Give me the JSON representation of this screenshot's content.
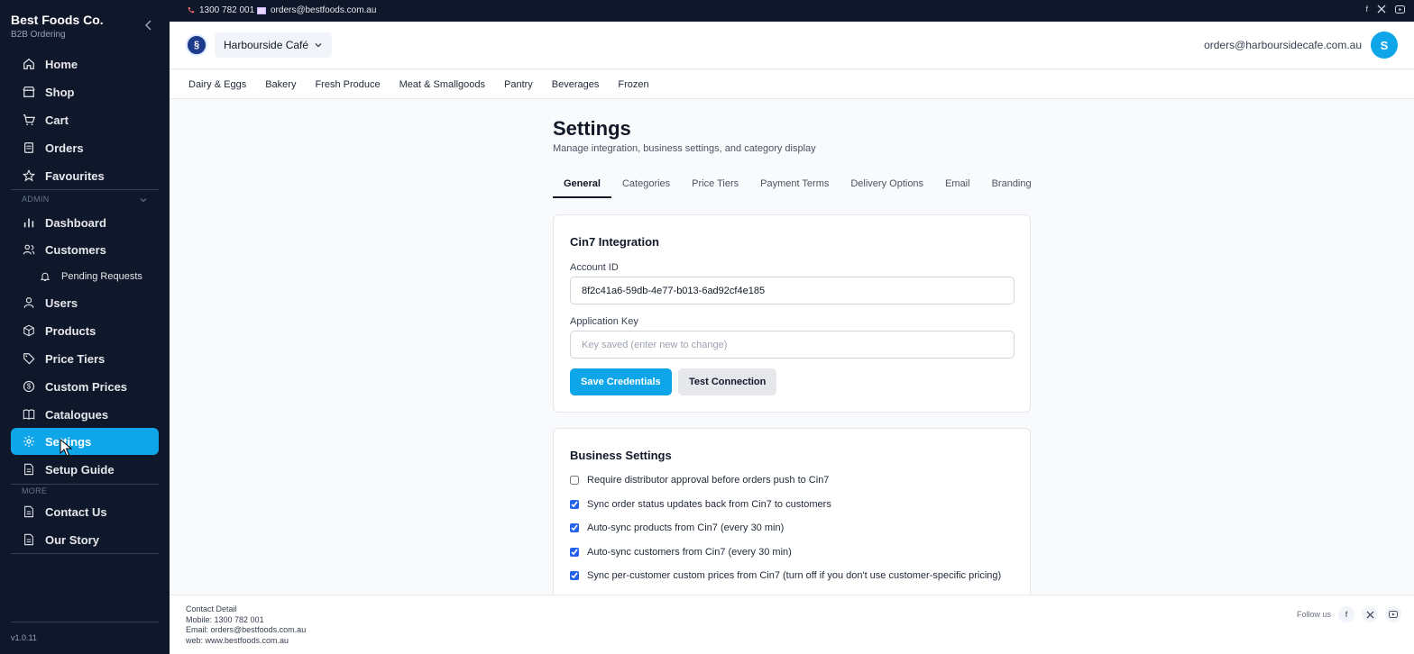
{
  "brand": {
    "name": "Best Foods Co.",
    "subtitle": "B2B Ordering",
    "version": "v1.0.11"
  },
  "sidebar": {
    "main_items": [
      {
        "label": "Home",
        "icon": "home-icon"
      },
      {
        "label": "Shop",
        "icon": "store-icon"
      },
      {
        "label": "Cart",
        "icon": "cart-icon"
      },
      {
        "label": "Orders",
        "icon": "orders-icon"
      },
      {
        "label": "Favourites",
        "icon": "star-icon"
      }
    ],
    "admin_label": "ADMIN",
    "admin_items": [
      {
        "label": "Dashboard",
        "icon": "bar-chart-icon"
      },
      {
        "label": "Customers",
        "icon": "customers-icon"
      },
      {
        "label": "Pending Requests",
        "icon": "bell-icon"
      },
      {
        "label": "Users",
        "icon": "user-icon"
      },
      {
        "label": "Products",
        "icon": "box-icon"
      },
      {
        "label": "Price Tiers",
        "icon": "tag-icon"
      },
      {
        "label": "Custom Prices",
        "icon": "dollar-icon"
      },
      {
        "label": "Catalogues",
        "icon": "book-icon"
      },
      {
        "label": "Settings",
        "icon": "gear-icon"
      },
      {
        "label": "Setup Guide",
        "icon": "document-icon"
      }
    ],
    "more_label": "MORE",
    "more_items": [
      {
        "label": "Contact Us",
        "icon": "document-icon"
      },
      {
        "label": "Our Story",
        "icon": "document-icon"
      }
    ],
    "active": "Settings"
  },
  "topbar": {
    "phone": "1300 782 001",
    "email": "orders@bestfoods.com.au",
    "social": [
      "f",
      "X",
      "youtube"
    ]
  },
  "header": {
    "org_name": "Harbourside Café",
    "user_email": "orders@harboursidecafe.com.au",
    "avatar_initial": "S"
  },
  "categories": [
    "Dairy & Eggs",
    "Bakery",
    "Fresh Produce",
    "Meat & Smallgoods",
    "Pantry",
    "Beverages",
    "Frozen"
  ],
  "page": {
    "title": "Settings",
    "subtitle": "Manage integration, business settings, and category display",
    "tabs": [
      "General",
      "Categories",
      "Price Tiers",
      "Payment Terms",
      "Delivery Options",
      "Email",
      "Branding"
    ],
    "active_tab": "General"
  },
  "integration": {
    "title": "Cin7 Integration",
    "account_id_label": "Account ID",
    "account_id_value": "8f2c41a6-59db-4e77-b013-6ad92cf4e185",
    "app_key_label": "Application Key",
    "app_key_placeholder": "Key saved (enter new to change)",
    "save_label": "Save Credentials",
    "test_label": "Test Connection"
  },
  "business": {
    "title": "Business Settings",
    "options": [
      {
        "label": "Require distributor approval before orders push to Cin7",
        "checked": false
      },
      {
        "label": "Sync order status updates back from Cin7 to customers",
        "checked": true
      },
      {
        "label": "Auto-sync products from Cin7 (every 30 min)",
        "checked": true
      },
      {
        "label": "Auto-sync customers from Cin7 (every 30 min)",
        "checked": true
      },
      {
        "label": "Sync per-customer custom prices from Cin7 (turn off if you don't use customer-specific pricing)",
        "checked": true
      }
    ]
  },
  "footer": {
    "heading": "Contact Detail",
    "mobile": "Mobile: 1300 782 001",
    "email": "Email: orders@bestfoods.com.au",
    "web": "web: www.bestfoods.com.au",
    "follow_label": "Follow us"
  },
  "colors": {
    "sidebar_bg": "#0f172a",
    "accent": "#0ea5e9"
  }
}
